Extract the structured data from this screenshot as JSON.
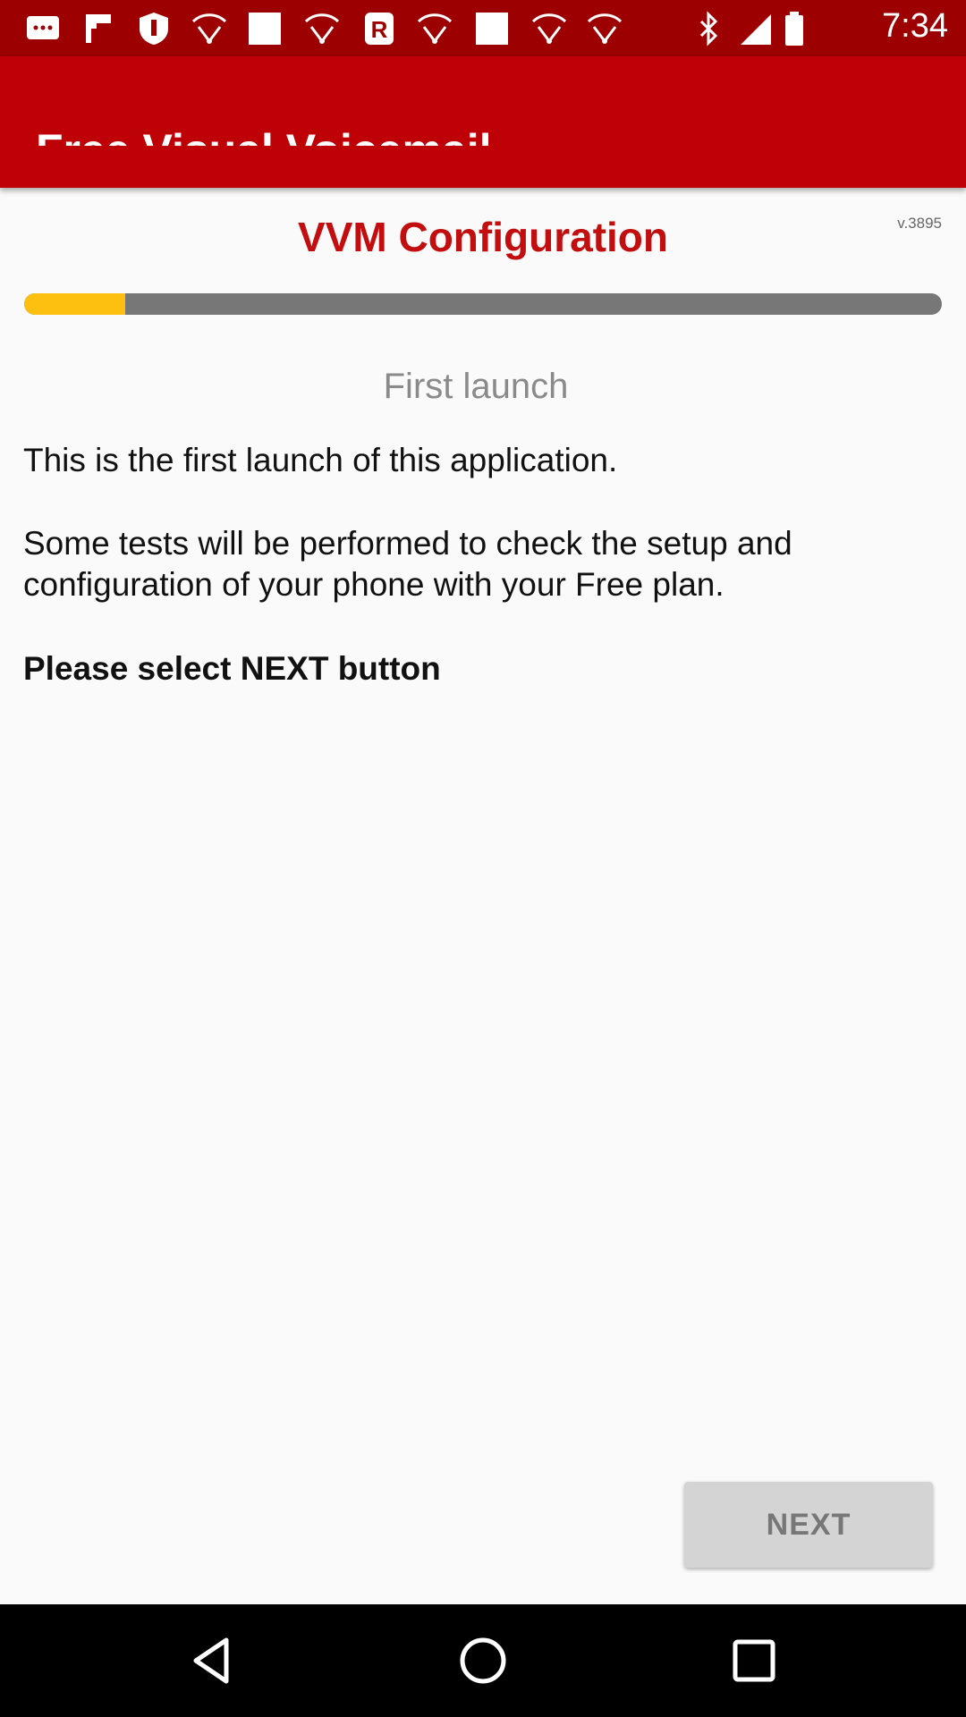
{
  "status_bar": {
    "time": "7:34",
    "icons": [
      "message-icon",
      "flag-icon",
      "shield-icon",
      "wifi-icon",
      "square-icon",
      "wifi-icon",
      "r-app-icon",
      "wifi-icon",
      "square-icon",
      "wifi-icon",
      "wifi-icon",
      "bluetooth-icon",
      "signal-icon",
      "battery-icon"
    ]
  },
  "app_bar": {
    "title": "Free Visual Voicemail"
  },
  "config": {
    "title": "VVM Configuration",
    "version": "v.3895",
    "progress_fraction": 0.11
  },
  "content": {
    "section_title": "First launch",
    "paragraph1": "This is the first launch of this application.",
    "paragraph2": "Some tests will be performed to check the setup and configuration of your phone with your Free plan.",
    "instruction": "Please select NEXT button"
  },
  "buttons": {
    "next": "NEXT"
  },
  "colors": {
    "status_bar": "#9d0000",
    "app_bar": "#be0007",
    "accent_title": "#c20e0e",
    "progress_fill": "#fdc010",
    "progress_track": "#777777"
  },
  "nav": {
    "icons": [
      "back-icon",
      "home-icon",
      "recents-icon"
    ]
  }
}
